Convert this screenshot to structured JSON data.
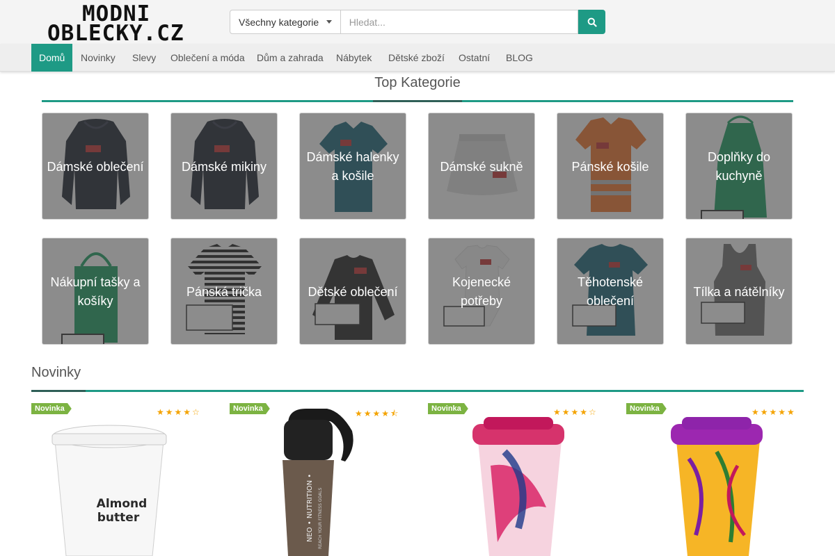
{
  "logo": {
    "line1": "MODNI",
    "line2": "OBLECKY.CZ"
  },
  "search": {
    "category": "Všechny kategorie",
    "placeholder": "Hledat..."
  },
  "nav": [
    "Domů",
    "Novinky",
    "Slevy",
    "Oblečení a móda",
    "Dům a zahrada",
    "Nábytek",
    "Dětské zboží",
    "Ostatní",
    "BLOG"
  ],
  "colors": {
    "accent": "#1e9a85",
    "badge": "#7cb342",
    "stars": "#f4a300"
  },
  "top_categories": {
    "title": "Top Kategorie",
    "items": [
      {
        "label": "Dámské oblečení",
        "icon": "black-hoodie"
      },
      {
        "label": "Dámské mikiny",
        "icon": "black-hoodie"
      },
      {
        "label": "Dámské halenky a košile",
        "icon": "teal-polo"
      },
      {
        "label": "Dámské sukně",
        "icon": "grey-skirt"
      },
      {
        "label": "Pánské košile",
        "icon": "orange-hivis-shirt"
      },
      {
        "label": "Doplňky do kuchyně",
        "icon": "green-apron"
      },
      {
        "label": "Nákupní tašky a košíky",
        "icon": "green-bag"
      },
      {
        "label": "Pánská trička",
        "icon": "striped-tshirt"
      },
      {
        "label": "Dětské oblečení",
        "icon": "black-sweatshirt"
      },
      {
        "label": "Kojenecké potřeby",
        "icon": "white-bodysuit"
      },
      {
        "label": "Těhotenské oblečení",
        "icon": "teal-tshirt"
      },
      {
        "label": "Tílka a nátělníky",
        "icon": "grey-tank-top"
      }
    ]
  },
  "novinky": {
    "title": "Novinky",
    "products": [
      {
        "badge": "Novinka",
        "rating": 4,
        "rating_max": 5,
        "image": "almond-butter-bucket",
        "image_text_1": "Almond",
        "image_text_2": "butter"
      },
      {
        "badge": "Novinka",
        "rating": 4.5,
        "rating_max": 5,
        "image": "protein-shaker",
        "image_text_1": "NEO • NUTRITION •",
        "image_text_2": "REACH YOUR FITNESS GOALS"
      },
      {
        "badge": "Novinka",
        "rating": 4,
        "rating_max": 5,
        "image": "pink-floral-travel-mug"
      },
      {
        "badge": "Novinka",
        "rating": 5,
        "rating_max": 5,
        "image": "yellow-leaf-travel-mug"
      }
    ]
  }
}
